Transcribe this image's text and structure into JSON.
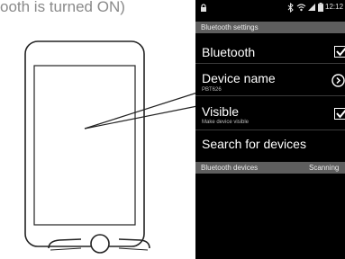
{
  "caption": "ooth is turned ON)",
  "status_bar": {
    "time": "12:12",
    "icons": [
      "lock-icon",
      "bluetooth-icon",
      "wifi-icon",
      "signal-icon",
      "battery-icon"
    ]
  },
  "screen": {
    "header": "Bluetooth settings",
    "items": [
      {
        "title": "Bluetooth",
        "subtitle": "",
        "control": "checkbox",
        "checked": true
      },
      {
        "title": "Device name",
        "subtitle": "PBT626",
        "control": "chevron-right-icon"
      },
      {
        "title": "Visible",
        "subtitle": "Make device visible",
        "control": "checkbox",
        "checked": true
      },
      {
        "title": "Search for devices",
        "subtitle": ""
      }
    ],
    "devices_header": {
      "label": "Bluetooth devices",
      "status": "Scanning"
    }
  },
  "colors": {
    "screen_bg": "#000000",
    "header_bg": "#5e5e5e",
    "illustration_stroke": "#222222",
    "caption_text": "#8a8a8a"
  }
}
